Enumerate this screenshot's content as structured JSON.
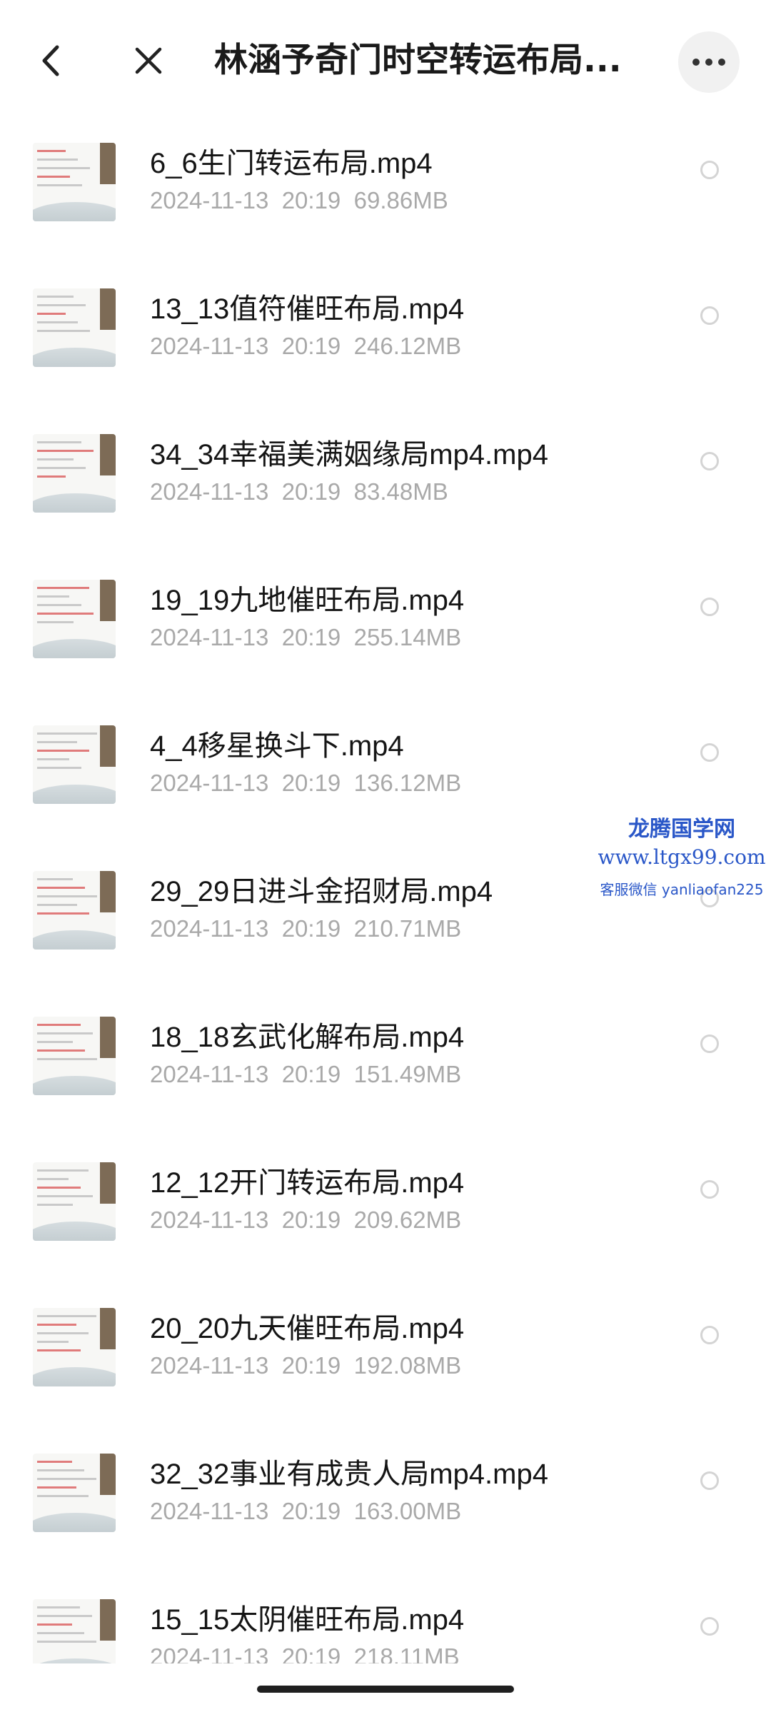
{
  "header": {
    "title": "林涵予奇门时空转运布局...",
    "back_icon": "chevron-left-icon",
    "close_icon": "close-icon",
    "more_icon": "more-horizontal-icon"
  },
  "files": [
    {
      "name": "6_6生门转运布局.mp4",
      "date": "2024-11-13",
      "time": "20:19",
      "size": "69.86MB"
    },
    {
      "name": "13_13值符催旺布局.mp4",
      "date": "2024-11-13",
      "time": "20:19",
      "size": "246.12MB"
    },
    {
      "name": "34_34幸福美满姻缘局mp4.mp4",
      "date": "2024-11-13",
      "time": "20:19",
      "size": "83.48MB"
    },
    {
      "name": "19_19九地催旺布局.mp4",
      "date": "2024-11-13",
      "time": "20:19",
      "size": "255.14MB"
    },
    {
      "name": "4_4移星换斗下.mp4",
      "date": "2024-11-13",
      "time": "20:19",
      "size": "136.12MB"
    },
    {
      "name": "29_29日进斗金招财局.mp4",
      "date": "2024-11-13",
      "time": "20:19",
      "size": "210.71MB"
    },
    {
      "name": "18_18玄武化解布局.mp4",
      "date": "2024-11-13",
      "time": "20:19",
      "size": "151.49MB"
    },
    {
      "name": "12_12开门转运布局.mp4",
      "date": "2024-11-13",
      "time": "20:19",
      "size": "209.62MB"
    },
    {
      "name": "20_20九天催旺布局.mp4",
      "date": "2024-11-13",
      "time": "20:19",
      "size": "192.08MB"
    },
    {
      "name": "32_32事业有成贵人局mp4.mp4",
      "date": "2024-11-13",
      "time": "20:19",
      "size": "163.00MB"
    },
    {
      "name": "15_15太阴催旺布局.mp4",
      "date": "2024-11-13",
      "time": "20:19",
      "size": "218.11MB"
    }
  ],
  "watermark": {
    "line1": "龙腾国学网",
    "line2": "www.ltgx99.com",
    "line3": "客服微信 yanliaofan225"
  },
  "colors": {
    "background": "#ffffff",
    "meta_text": "#a9a9a9",
    "watermark": "#2a57c8"
  }
}
